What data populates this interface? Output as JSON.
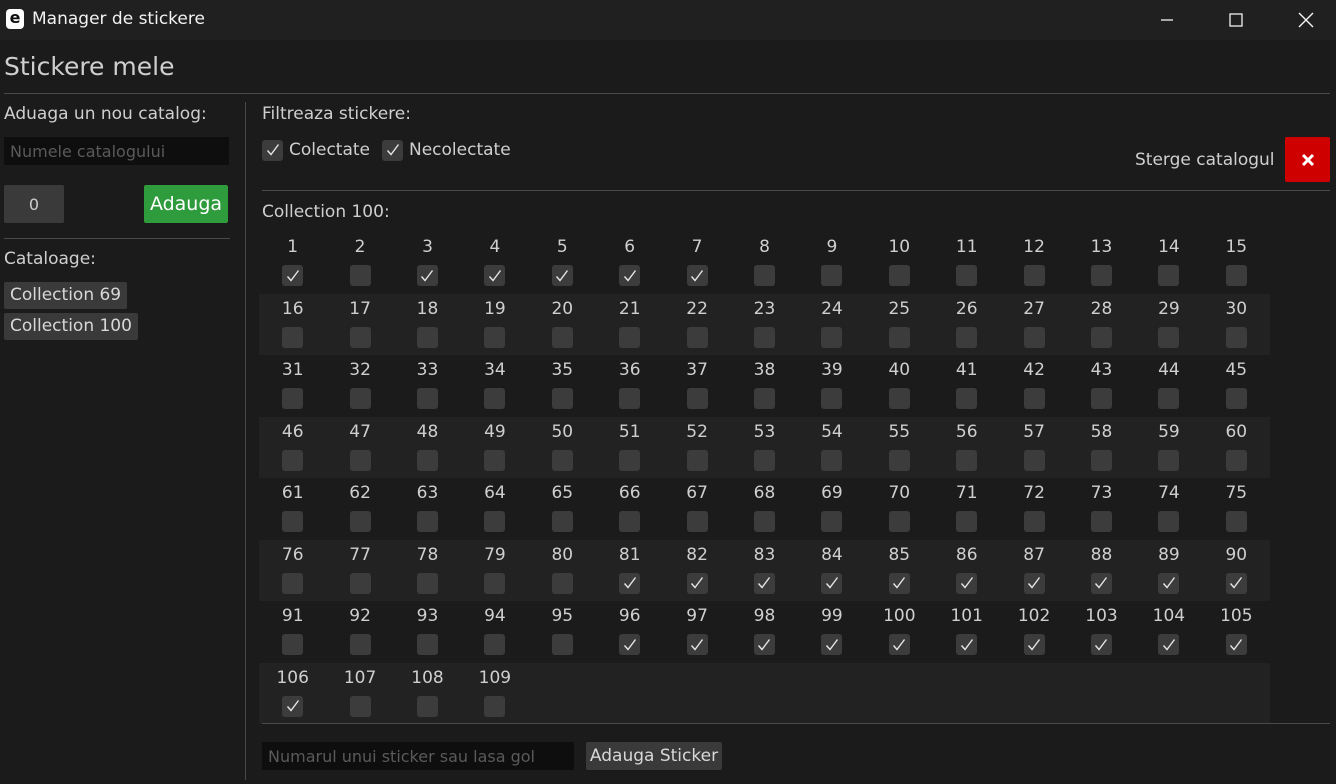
{
  "window": {
    "icon": "e",
    "title": "Manager de stickere",
    "minimize_icon": "minimize-icon",
    "maximize_icon": "maximize-icon",
    "close_icon": "close-icon"
  },
  "header": {
    "title": "Stickere mele"
  },
  "sidebar": {
    "add_catalog_label": "Aduaga un nou catalog:",
    "catalog_name_placeholder": "Numele catalogului",
    "catalog_name_value": "",
    "count_value": "0",
    "add_button_label": "Adauga",
    "catalogs_label": "Cataloage:",
    "catalogs": [
      "Collection 69",
      "Collection 100"
    ]
  },
  "main": {
    "filter_label": "Filtreaza stickere:",
    "filters": [
      {
        "label": "Colectate",
        "checked": true
      },
      {
        "label": "Necolectate",
        "checked": true
      }
    ],
    "delete_label": "Sterge catalogul",
    "delete_icon": "close-icon",
    "collection_label": "Collection 100:",
    "columns": 15,
    "total": 109,
    "collected": [
      1,
      3,
      4,
      5,
      6,
      7,
      81,
      82,
      83,
      84,
      85,
      86,
      87,
      88,
      89,
      90,
      96,
      97,
      98,
      99,
      100,
      101,
      102,
      103,
      104,
      105,
      106
    ],
    "sticker_input_placeholder": "Numarul unui sticker sau lasa gol",
    "sticker_input_value": "",
    "add_sticker_label": "Adauga Sticker"
  },
  "colors": {
    "background": "#1b1b1b",
    "accent_green": "#2e9b3c",
    "danger_red": "#cf0000",
    "alt_row": "#222222",
    "checkbox": "#3c3c3c"
  }
}
